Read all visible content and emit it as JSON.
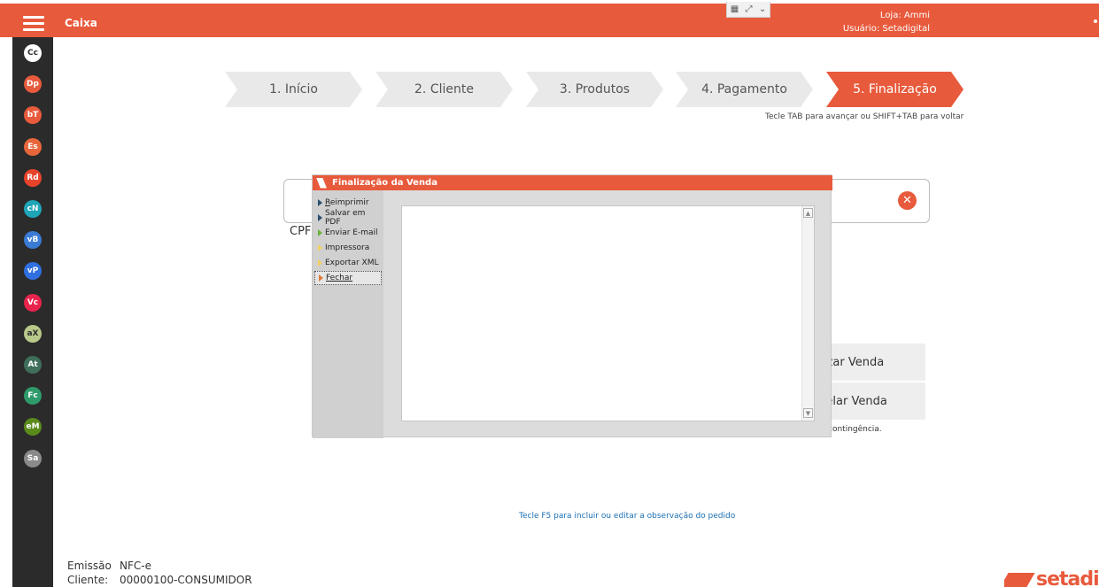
{
  "app": {
    "title": "Caixa",
    "loja": "Loja:  Ammi",
    "usuario": "Usuário:  Setadigital"
  },
  "keyboard_control": {
    "grid_icon": "keyboard-grid-icon",
    "expand_icon": "expand-icon",
    "chevron_icon": "chevron-down-icon"
  },
  "sidebar": {
    "items": [
      {
        "code": "Cc",
        "color": "#ffffff",
        "text_color": "#2b2b2b"
      },
      {
        "code": "Dp",
        "color": "#e85a3c"
      },
      {
        "code": "bT",
        "color": "#e85a3c"
      },
      {
        "code": "Es",
        "color": "#e8663c"
      },
      {
        "code": "Rd",
        "color": "#e8442c"
      },
      {
        "code": "cN",
        "color": "#1fa5b8"
      },
      {
        "code": "vB",
        "color": "#3a7bd5"
      },
      {
        "code": "vP",
        "color": "#2f6fe0"
      },
      {
        "code": "Vc",
        "color": "#e8244c"
      },
      {
        "code": "aX",
        "color": "#b8c98a",
        "text_color": "#2b2b2b"
      },
      {
        "code": "At",
        "color": "#3f6f5a"
      },
      {
        "code": "Fc",
        "color": "#2f9a6a"
      },
      {
        "code": "eM",
        "color": "#5a8a1c"
      },
      {
        "code": "Sa",
        "color": "#8a8a8a"
      }
    ]
  },
  "steps": [
    {
      "label": "1. Início",
      "active": false
    },
    {
      "label": "2. Cliente",
      "active": false
    },
    {
      "label": "3. Produtos",
      "active": false
    },
    {
      "label": "4. Pagamento",
      "active": false
    },
    {
      "label": "5. Finalização",
      "active": true
    }
  ],
  "step_hint": "Tecle TAB para avançar ou SHIFT+TAB para voltar",
  "background": {
    "cpf_label": "CPF",
    "finalizar_label": "Finalizar Venda",
    "cancelar_label": "Cancelar Venda",
    "contingencia_text": "contingência.",
    "f5_hint": "Tecle F5 para incluir ou editar a observação do pedido"
  },
  "dialog": {
    "title": "Finalização da Venda",
    "menu": [
      {
        "label": "Reimprimir",
        "icon": "blue-arrow-icon"
      },
      {
        "label": "Salvar em PDF",
        "icon": "blue-arrow-icon"
      },
      {
        "label": "Enviar E-mail",
        "icon": "green-arrow-icon"
      },
      {
        "label": "Impressora",
        "icon": "yellow-arrow-icon"
      },
      {
        "label": "Exportar XML",
        "icon": "yellow-arrow-icon"
      },
      {
        "label": "Fechar",
        "icon": "orange-arrow-icon"
      }
    ]
  },
  "footer": {
    "emissao_label": "Emissão",
    "emissao_value": "NFC-e",
    "cliente_label": "Cliente:",
    "cliente_value": "00000100-CONSUMIDOR",
    "brand": "setadigi"
  },
  "colors": {
    "accent": "#e85a3c",
    "sidebar": "#2b2b2b",
    "step_inactive": "#e9e9e9"
  }
}
